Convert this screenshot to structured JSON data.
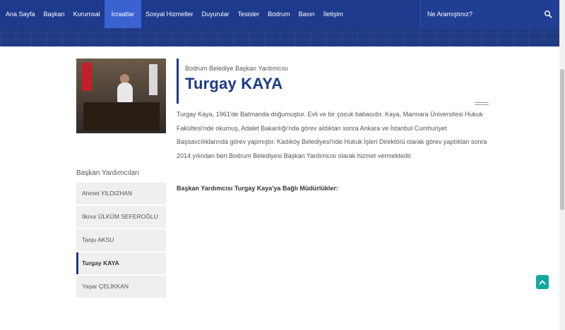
{
  "nav": {
    "items": [
      {
        "label": "Ana Sayfa"
      },
      {
        "label": "Başkan"
      },
      {
        "label": "Kurumsal"
      },
      {
        "label": "İcraatlar",
        "active": true
      },
      {
        "label": "Sosyal Hizmetler"
      },
      {
        "label": "Duyurular"
      },
      {
        "label": "Tesisler"
      },
      {
        "label": "Bodrum"
      },
      {
        "label": "Basın"
      },
      {
        "label": "İletişim"
      }
    ],
    "search_placeholder": "Ne Aramıştınız?"
  },
  "profile": {
    "subtitle": "Bodrum Belediye Başkan Yardımcısı",
    "name": "Turgay KAYA",
    "bio": "Turgay Kaya, 1961'de Batmanda doğumuştur. Evli ve bir çocuk babasıdır. Kaya, Marmara Üniversitesi Hukuk Fakültesi'nde okumuş, Adalet Bakanlığı'nda görev aldıktan sonra Ankara ve İstanbul Cumhuriyet Başsavcılıklarında görev yapmıştır. Kadıköy Belediyesi'nde Hukuk İşleri Direktörü olarak görev yaptıktan sonra 2014 yılından beri Bodrum Belediyesi Başkan Yardımcısı olarak hizmet vermektedir.",
    "section_heading": "Başkan Yardımcısı Turgay Kaya'ya Bağlı Müdürlükler:"
  },
  "sidebar": {
    "title": "Başkan Yardımcıları",
    "items": [
      {
        "label": "Ahmet YILDIZHAN"
      },
      {
        "label": "İlknur ÜLKÜM SEFEROĞLU"
      },
      {
        "label": "Tanju AKSU"
      },
      {
        "label": "Turgay KAYA",
        "active": true
      },
      {
        "label": "Yaşar ÇELİKKAN"
      }
    ]
  },
  "colors": {
    "nav_bg": "#1d3a8c",
    "nav_active": "#3a63d0",
    "accent": "#1d3a8c",
    "scroll_top": "#13a89e"
  },
  "icons": {
    "search": "search-icon",
    "scroll_top": "chevron-up-icon"
  }
}
